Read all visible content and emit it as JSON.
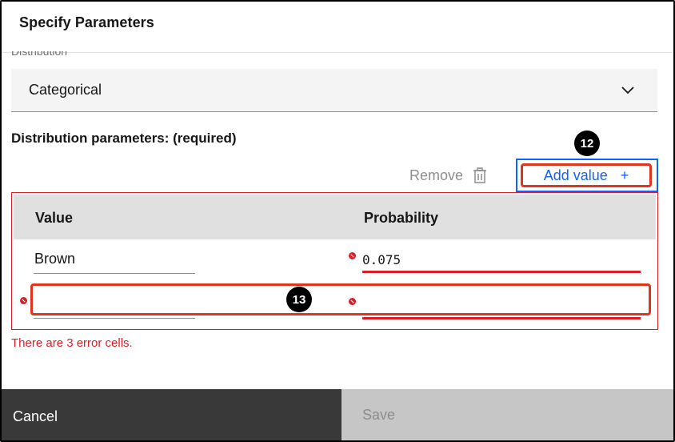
{
  "header": {
    "title": "Specify Parameters"
  },
  "distribution": {
    "label": "Distribution",
    "selected": "Categorical"
  },
  "params": {
    "title": "Distribution parameters: (required)",
    "remove_label": "Remove",
    "add_label": "Add value",
    "add_icon": "+",
    "columns": [
      "Value",
      "Probability"
    ],
    "rows": [
      {
        "value": "Brown",
        "probability": "0.075"
      },
      {
        "value": "",
        "probability": ""
      }
    ],
    "error_message": "There are 3 error cells."
  },
  "annotations": {
    "badge_a": "12",
    "badge_b": "13"
  },
  "footer": {
    "cancel_label": "Cancel",
    "save_label": "Save"
  },
  "colors": {
    "accent": "#0f62fe",
    "error": "#da1e28",
    "highlight": "#e0341d"
  },
  "icons": {
    "select_chevron": "chevron-down-icon",
    "remove": "trash-icon",
    "add": "plus-icon",
    "error": "error-icon"
  }
}
